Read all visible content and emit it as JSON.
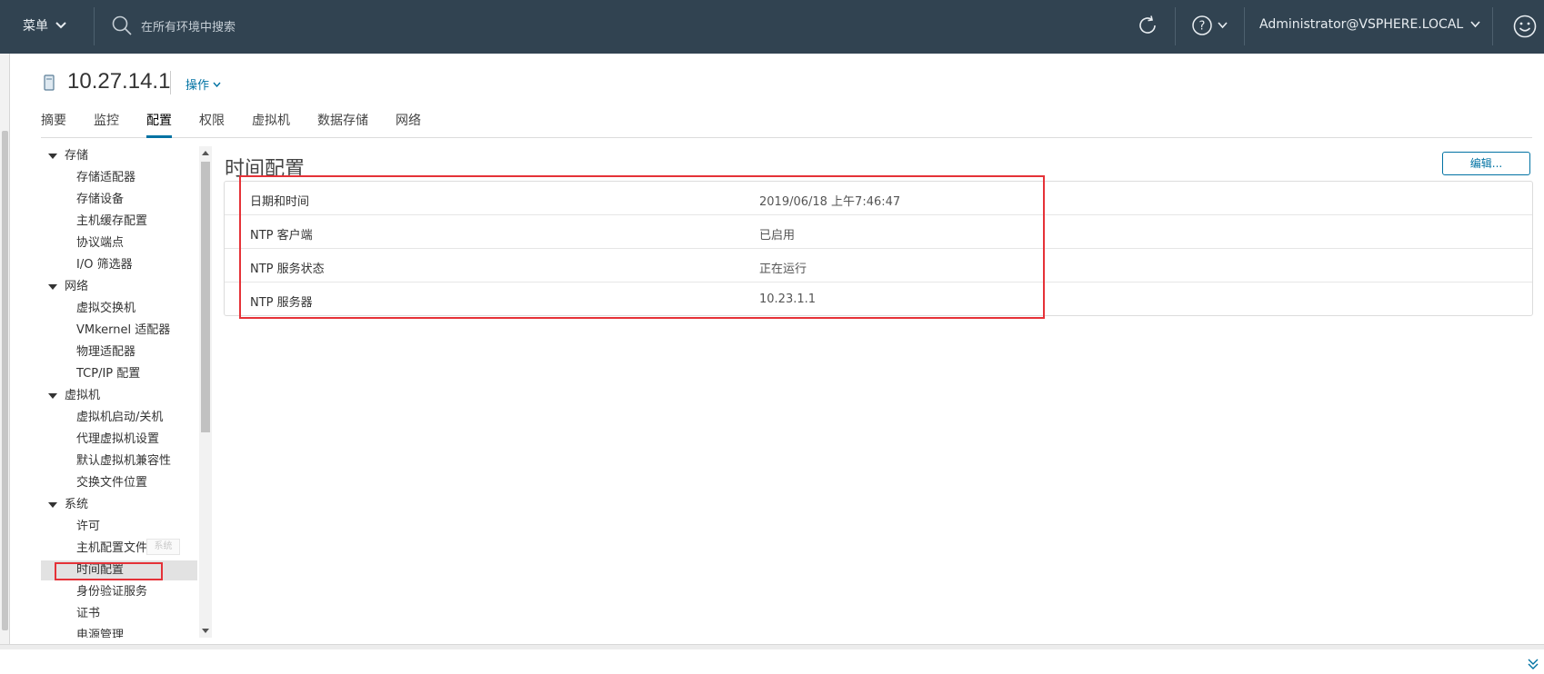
{
  "header": {
    "menu_label": "菜单",
    "search_placeholder": "在所有环境中搜索",
    "user": "Administrator@VSPHERE.LOCAL"
  },
  "object": {
    "title": "10.27.14.1",
    "actions_label": "操作"
  },
  "tabs": [
    "摘要",
    "监控",
    "配置",
    "权限",
    "虚拟机",
    "数据存储",
    "网络"
  ],
  "active_tab": "配置",
  "tree": {
    "groups": [
      {
        "label": "存储",
        "items": [
          "存储适配器",
          "存储设备",
          "主机缓存配置",
          "协议端点",
          "I/O 筛选器"
        ]
      },
      {
        "label": "网络",
        "items": [
          "虚拟交换机",
          "VMkernel 适配器",
          "物理适配器",
          "TCP/IP 配置"
        ]
      },
      {
        "label": "虚拟机",
        "items": [
          "虚拟机启动/关机",
          "代理虚拟机设置",
          "默认虚拟机兼容性",
          "交换文件位置"
        ]
      },
      {
        "label": "系统",
        "items": [
          "许可",
          "主机配置文件",
          "时间配置",
          "身份验证服务",
          "证书",
          "电源管理"
        ]
      }
    ],
    "selected": "时间配置",
    "tooltip": "系统"
  },
  "content": {
    "title": "时间配置",
    "edit_label": "编辑...",
    "rows": [
      {
        "key": "日期和时间",
        "value": "2019/06/18 上午7:46:47"
      },
      {
        "key": "NTP 客户端",
        "value": "已启用"
      },
      {
        "key": "NTP 服务状态",
        "value": "正在运行"
      },
      {
        "key": "NTP 服务器",
        "value": "10.23.1.1"
      }
    ]
  },
  "colors": {
    "header_bg": "#314351",
    "link": "#0072a3",
    "highlight_box": "#e53238"
  }
}
